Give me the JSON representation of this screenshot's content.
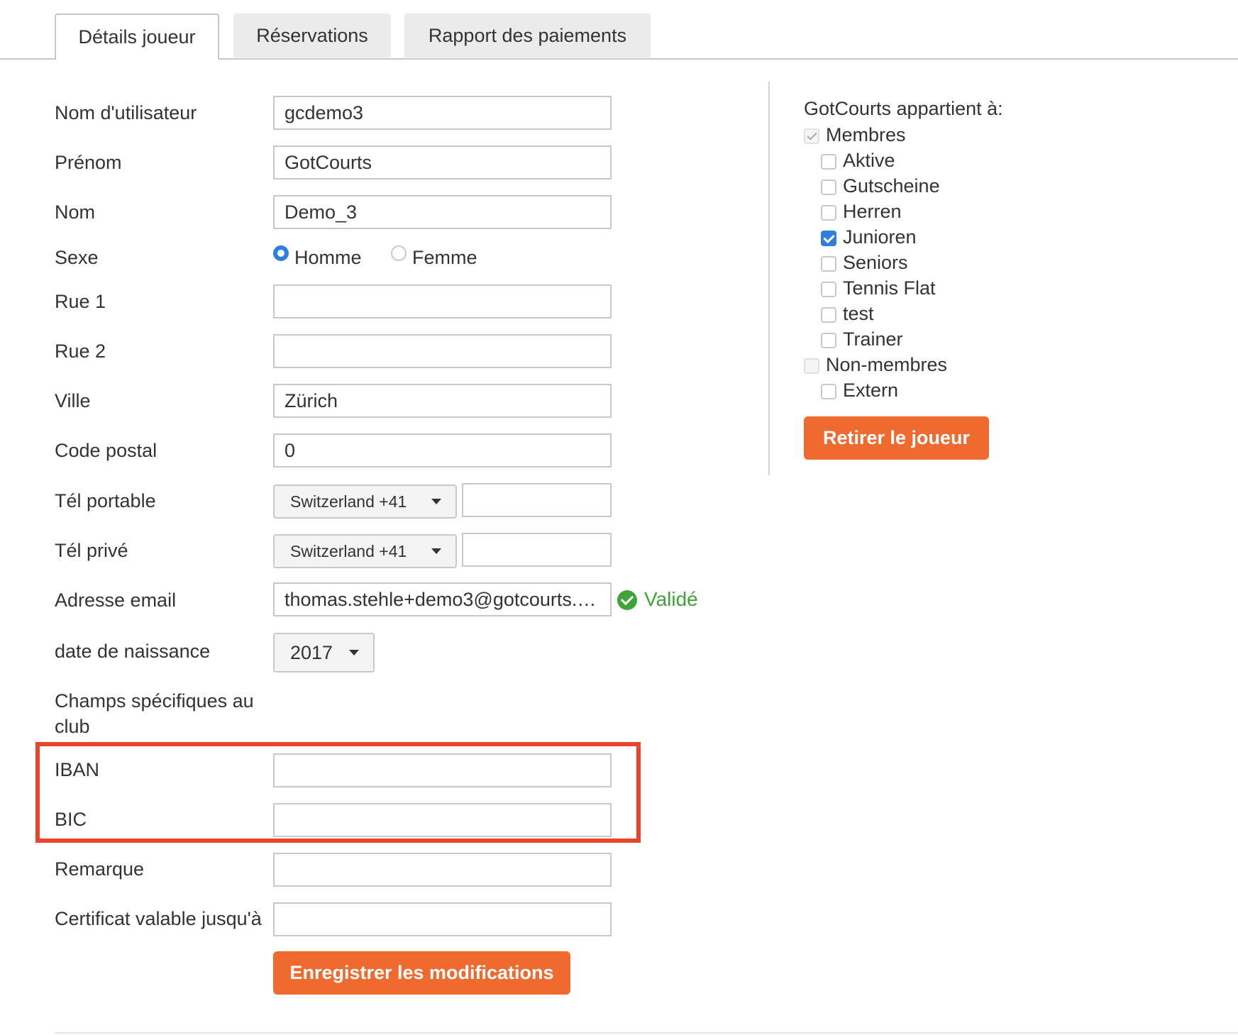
{
  "tabs": [
    {
      "label": "Détails joueur",
      "active": true
    },
    {
      "label": "Réservations",
      "active": false
    },
    {
      "label": "Rapport des paiements",
      "active": false
    }
  ],
  "form": {
    "username": {
      "label": "Nom d'utilisateur",
      "value": "gcdemo3"
    },
    "firstname": {
      "label": "Prénom",
      "value": "GotCourts"
    },
    "lastname": {
      "label": "Nom",
      "value": "Demo_3"
    },
    "gender": {
      "label": "Sexe",
      "options": [
        "Homme",
        "Femme"
      ],
      "selected": "Homme"
    },
    "street1": {
      "label": "Rue 1",
      "value": ""
    },
    "street2": {
      "label": "Rue 2",
      "value": ""
    },
    "city": {
      "label": "Ville",
      "value": "Zürich"
    },
    "zip": {
      "label": "Code postal",
      "value": "0"
    },
    "mobile": {
      "label": "Tél portable",
      "country": "Switzerland +41",
      "value": ""
    },
    "phone": {
      "label": "Tél privé",
      "country": "Switzerland +41",
      "value": ""
    },
    "email": {
      "label": "Adresse email",
      "value": "thomas.stehle+demo3@gotcourts.com",
      "status": "Validé"
    },
    "birthdate": {
      "label": "date de naissance",
      "year": "2017"
    },
    "club_fields": {
      "label": "Champs spécifiques au club"
    },
    "iban": {
      "label": "IBAN",
      "value": ""
    },
    "bic": {
      "label": "BIC",
      "value": ""
    },
    "remark": {
      "label": "Remarque",
      "value": ""
    },
    "certificate": {
      "label": "Certificat valable jusqu'à",
      "value": ""
    },
    "save_button": "Enregistrer les modifications"
  },
  "groups": {
    "title": "GotCourts appartient à:",
    "items": [
      {
        "label": "Membres",
        "checked": true,
        "disabled": true,
        "level": 0
      },
      {
        "label": "Aktive",
        "checked": false,
        "level": 1
      },
      {
        "label": "Gutscheine",
        "checked": false,
        "level": 1
      },
      {
        "label": "Herren",
        "checked": false,
        "level": 1
      },
      {
        "label": "Junioren",
        "checked": true,
        "level": 1
      },
      {
        "label": "Seniors",
        "checked": false,
        "level": 1
      },
      {
        "label": "Tennis Flat",
        "checked": false,
        "level": 1
      },
      {
        "label": "test",
        "checked": false,
        "level": 1
      },
      {
        "label": "Trainer",
        "checked": false,
        "level": 1
      },
      {
        "label": "Non-membres",
        "checked": false,
        "disabled": true,
        "level": 0
      },
      {
        "label": "Extern",
        "checked": false,
        "level": 1
      }
    ],
    "remove_button": "Retirer le joueur"
  },
  "colors": {
    "accent": "#ee6a2f",
    "highlight": "#e8452c",
    "valid": "#3fa33a",
    "checkbox": "#2f7de1"
  }
}
